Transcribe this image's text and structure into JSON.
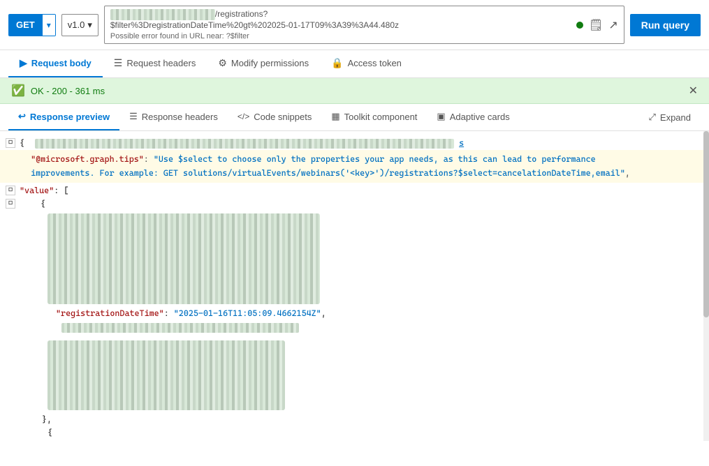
{
  "toolbar": {
    "method": "GET",
    "method_dropdown_icon": "▾",
    "version": "v1.0",
    "version_dropdown_icon": "▾",
    "url": "/registrations?$filter%3DregistrationDateTime%20gt%202025-01-17T09%3A39%3A44.480z",
    "url_prefix": "...",
    "url_error": "Possible error found in URL near: ?$filter",
    "run_button_label": "Run query",
    "save_icon": "💾",
    "share_icon": "↗"
  },
  "tabs": [
    {
      "id": "request-body",
      "label": "Request body",
      "icon": "▶",
      "active": true
    },
    {
      "id": "request-headers",
      "label": "Request headers",
      "icon": "≡"
    },
    {
      "id": "modify-permissions",
      "label": "Modify permissions",
      "icon": "⚙"
    },
    {
      "id": "access-token",
      "label": "Access token",
      "icon": "🔒"
    }
  ],
  "status": {
    "icon": "✓",
    "text": "OK - 200 - 361 ms",
    "close_icon": "✕"
  },
  "response_tabs": [
    {
      "id": "response-preview",
      "label": "Response preview",
      "icon": "↩",
      "active": true
    },
    {
      "id": "response-headers",
      "label": "Response headers",
      "icon": "≡"
    },
    {
      "id": "code-snippets",
      "label": "Code snippets",
      "icon": "⟨/⟩"
    },
    {
      "id": "toolkit-component",
      "label": "Toolkit component",
      "icon": "▦"
    },
    {
      "id": "adaptive-cards",
      "label": "Adaptive cards",
      "icon": "▣"
    }
  ],
  "expand": {
    "label": "Expand",
    "icon": "⤢"
  },
  "response_code": {
    "line1": "{",
    "tip_key": "@microsoft.graph.tips",
    "tip_value": "\"Use $select to choose only the properties your app needs, as this can lead to performance improvements. For example: GET solutions/virtualEvents/webinars('<key>')/registrations?$select=cancelationDateTime,email\"",
    "value_key": "\"value\"",
    "value_bracket": "[",
    "reg_key": "\"registrationDateTime\"",
    "reg_value": "\"2025-01-16T11:05:09.4662154Z\"",
    "close_bracket1": "},",
    "close_bracket2": "{"
  }
}
